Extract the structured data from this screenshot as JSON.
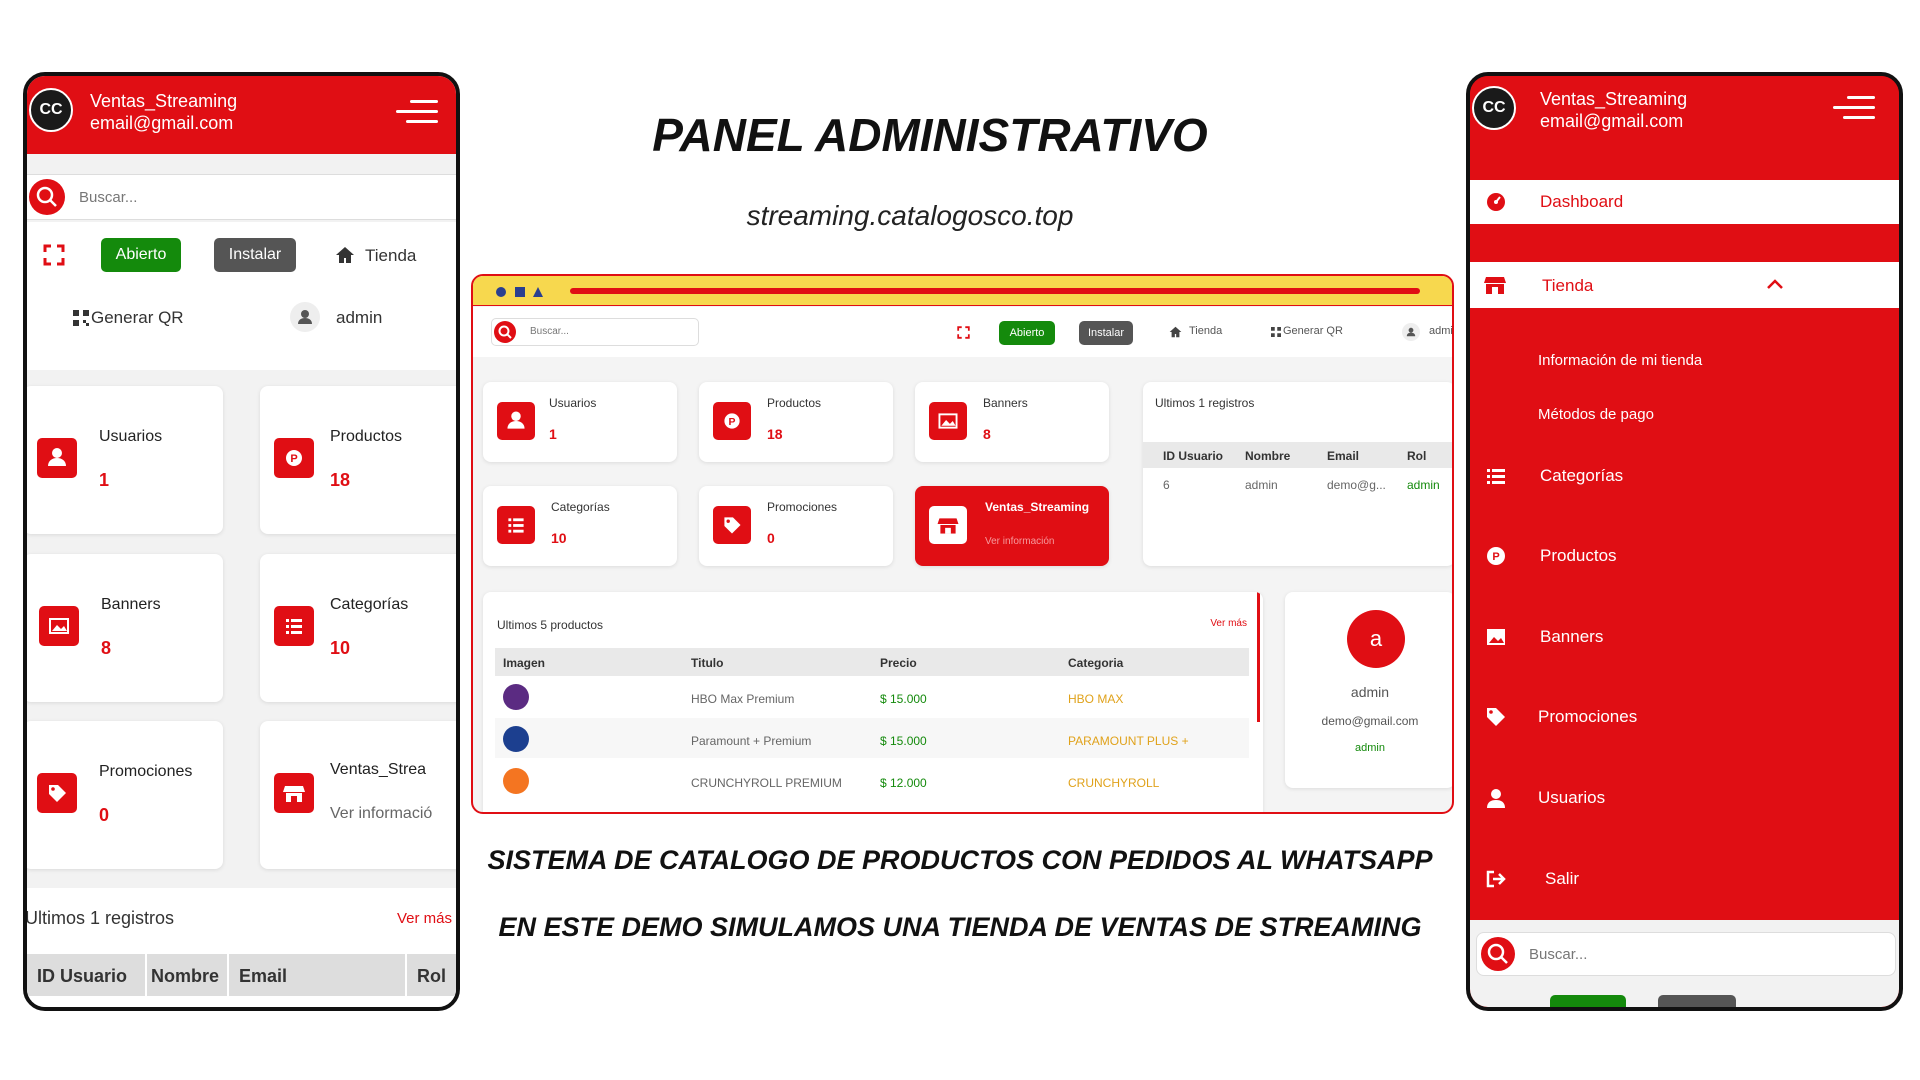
{
  "headline": "PANEL ADMINISTRATIVO",
  "url": "streaming.catalogosco.top",
  "footer_lines": [
    "SISTEMA DE CATALOGO DE PRODUCTOS CON PEDIDOS AL WHATSAPP",
    "EN ESTE DEMO SIMULAMOS UNA TIENDA DE VENTAS DE STREAMING"
  ],
  "colors": {
    "brand_red": "#e00e14",
    "green": "#148a0c",
    "gray_button": "#555555",
    "browser_bar": "#f7d84e",
    "link_gold": "#e0a21b"
  },
  "app": {
    "logo_text": "CC",
    "store_name": "Ventas_Streaming",
    "email": "email@gmail.com"
  },
  "toolbar": {
    "search_placeholder": "Buscar...",
    "open_label": "Abierto",
    "install_label": "Instalar",
    "store_label": "Tienda",
    "qr_label": "Generar QR",
    "user_label": "admin"
  },
  "stats": {
    "users": {
      "label": "Usuarios",
      "value": "1"
    },
    "products": {
      "label": "Productos",
      "value": "18"
    },
    "banners": {
      "label": "Banners",
      "value": "8"
    },
    "categories": {
      "label": "Categorías",
      "value": "10"
    },
    "promotions": {
      "label": "Promociones",
      "value": "0"
    },
    "store": {
      "label": "Ventas_Streaming",
      "sub": "Ver información"
    }
  },
  "phone_left": {
    "store_card_label": "Ventas_Strea",
    "store_card_sub": "Ver informació"
  },
  "records": {
    "title": "Ultimos 1 registros",
    "see_more": "Ver más",
    "columns": [
      "ID Usuario",
      "Nombre",
      "Email",
      "Rol"
    ],
    "row": [
      "6",
      "admin",
      "demo@g...",
      "admin"
    ]
  },
  "products_table": {
    "title": "Ultimos 5 productos",
    "see_more": "Ver más",
    "columns": [
      "Imagen",
      "Titulo",
      "Precio",
      "Categoria"
    ],
    "rows": [
      {
        "title": "HBO Max Premium",
        "price": "$ 15.000",
        "category": "HBO MAX"
      },
      {
        "title": "Paramount + Premium",
        "price": "$ 15.000",
        "category": "PARAMOUNT PLUS +"
      },
      {
        "title": "CRUNCHYROLL PREMIUM",
        "price": "$ 12.000",
        "category": "CRUNCHYROLL"
      }
    ]
  },
  "profile": {
    "initial": "a",
    "name": "admin",
    "email": "demo@gmail.com",
    "role": "admin"
  },
  "menu": {
    "dashboard": "Dashboard",
    "store": "Tienda",
    "store_info": "Información de mi tienda",
    "payment_methods": "Métodos de pago",
    "categories": "Categorías",
    "products": "Productos",
    "banners": "Banners",
    "promotions": "Promociones",
    "users": "Usuarios",
    "logout": "Salir"
  }
}
